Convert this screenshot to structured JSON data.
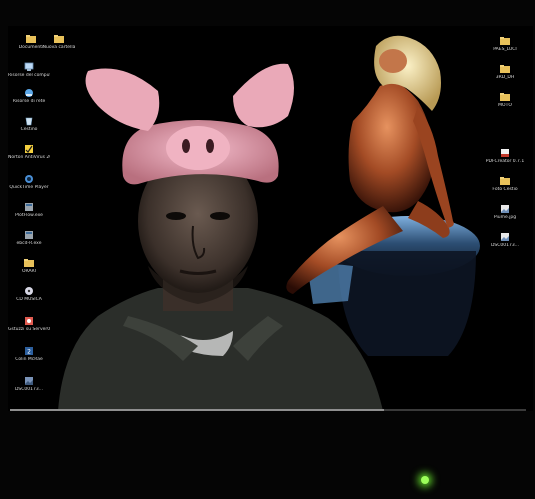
{
  "desktop": {
    "icons_left": [
      {
        "label": "Documenti",
        "icon": "folder-icon"
      },
      {
        "label": "Nuova cartella",
        "icon": "folder-icon"
      },
      {
        "label": "Risorse del computer",
        "icon": "my-computer-icon"
      },
      {
        "label": "Risorse di rete",
        "icon": "network-places-icon"
      },
      {
        "label": "Cestino",
        "icon": "recycle-bin-icon"
      },
      {
        "label": "Norton AntiVirus 2004",
        "icon": "norton-icon"
      },
      {
        "label": "QuickTime Player",
        "icon": "quicktime-icon"
      },
      {
        "label": "PlotFlow.exe",
        "icon": "app-icon"
      },
      {
        "label": "ebcd-R.exe",
        "icon": "app-icon"
      },
      {
        "label": "ORARI",
        "icon": "folder-icon"
      },
      {
        "label": "CD MUSICA",
        "icon": "cd-icon"
      },
      {
        "label": "Gstuzzi su Server01",
        "icon": "shortcut-icon"
      },
      {
        "label": "Colin McRae",
        "icon": "game-icon"
      },
      {
        "label": "DSC00173...",
        "icon": "image-file-icon"
      }
    ],
    "icons_right": [
      {
        "label": "PAES_LUCI",
        "icon": "folder-icon"
      },
      {
        "label": "3RD_DH",
        "icon": "folder-icon"
      },
      {
        "label": "MOTO",
        "icon": "folder-icon"
      },
      {
        "label": "PDFCreator 0.7.1",
        "icon": "pdf-icon"
      },
      {
        "label": "Foto Cestio",
        "icon": "folder-icon"
      },
      {
        "label": "Piume.jpg",
        "icon": "image-file-icon"
      },
      {
        "label": "DSC00173...",
        "icon": "image-file-icon"
      }
    ]
  },
  "colors": {
    "folder": "#e8c15a",
    "screen_bg": "#000000",
    "power_led": "#9cff5a",
    "hat_pink": "#e9a7b6",
    "skin_warm": "#b5603a"
  }
}
